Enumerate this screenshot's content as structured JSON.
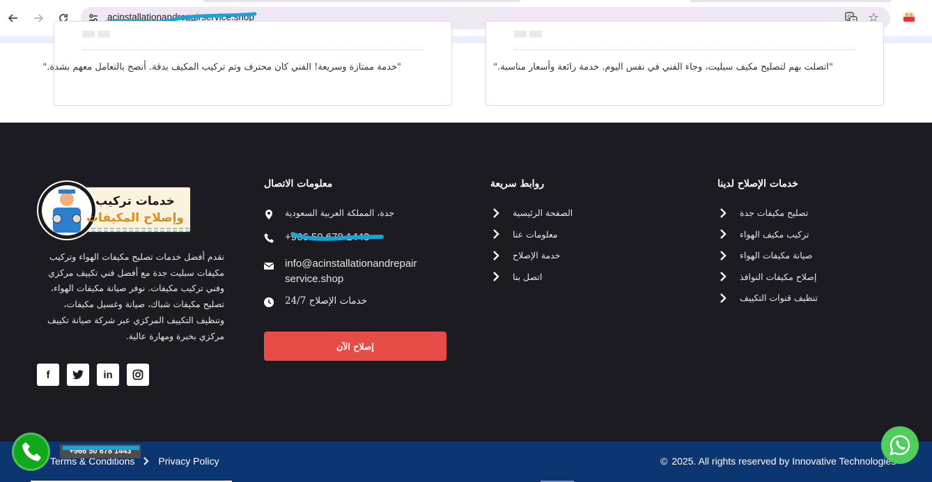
{
  "browser": {
    "url": "acinstallationandrepairservice.shop",
    "back_icon": "arrow-left-icon",
    "forward_icon": "arrow-right-icon",
    "reload_icon": "reload-icon"
  },
  "reviews": [
    {
      "quote": "\"خدمة ممتازة وسريعة! الفني كان محترف وتم تركيب المكيف بدقة. أنصح بالتعامل معهم بشدة.\""
    },
    {
      "quote": "\"اتصلت بهم لتصليح مكيف سبليت، وجاء الفني في نفس اليوم. خدمة رائعة وأسعار مناسبة.\""
    }
  ],
  "footer": {
    "about_text": "نقدم أفضل خدمات تصليح مكيفات الهواء وتركيب مكيفات سبليت جدة مع أفضل فني تكييف مركزي وفني تركيب مكيفات. نوفر صيانة مكيفات الهواء، تصليح مكيفات شباك، صيانة وغسيل مكيفات، وتنظيف التكييف المركزي عبر شركة صيانة تكييف مركزي بخبرة ومهارة عالية.",
    "logo_line1": "خدمات تركيب",
    "logo_line2": "وإصلاح المكيفات",
    "socials": [
      "f",
      "t",
      "in",
      "ig"
    ],
    "contact": {
      "title": "معلومات الاتصال",
      "location": "جدة، المملكة العربية السعودية",
      "phone": "+966 50 678 1443",
      "email": "info@acinstallationandrepairservice.shop",
      "hours": "خدمات الإصلاح 24/7",
      "button": "إصلاح الآن"
    },
    "quick_links": {
      "title": "روابط سريعة",
      "items": [
        "الصفحة الرئيسية",
        "معلومات عنا",
        "خدمة الإصلاح",
        "اتصل بنا"
      ]
    },
    "services": {
      "title": "خدمات الإصلاح لدينا",
      "items": [
        "تصليح مكيفات جدة",
        "تركيب مكيف الهواء",
        "صيانة مكيفات الهواء",
        "إصلاح مكيفات النوافذ",
        "تنظيف قنوات التكييف"
      ]
    }
  },
  "bottom_bar": {
    "terms": "Terms & Conditions",
    "privacy": "Privacy Policy",
    "copyright": "2025. All rights reserved by Innovative Technologies",
    "call_label": "+966 50 678 1443"
  },
  "colors": {
    "footer_bg": "#1c1b22",
    "bottom_bar_bg": "#0b3672",
    "button_red": "#e74c46",
    "call_green": "#11a81e",
    "whatsapp_green": "#4fce5d"
  }
}
